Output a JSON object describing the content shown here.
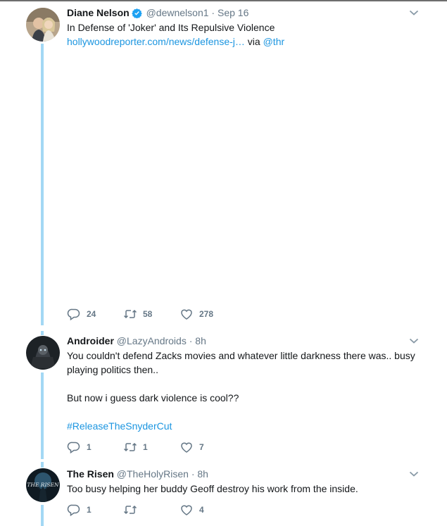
{
  "tweets": [
    {
      "name": "Diane Nelson",
      "verified": true,
      "handle": "@dewnelson1",
      "dot": "·",
      "time": "Sep 16",
      "text_line1": "In Defense of 'Joker' and Its Repulsive Violence",
      "link": "hollywoodreporter.com/news/defense-j…",
      "via": "via",
      "mention": "@thr",
      "replies": "24",
      "retweets": "58",
      "likes": "278"
    },
    {
      "name": "Androider",
      "handle": "@LazyAndroids",
      "dot": "·",
      "time": "8h",
      "text_line1": "You couldn't defend Zacks movies and whatever little darkness there was.. busy",
      "text_line2": "playing politics then..",
      "text_line3": "But now i guess dark violence is cool??",
      "hashtag": "#ReleaseTheSnyderCut",
      "replies": "1",
      "retweets": "1",
      "likes": "7"
    },
    {
      "name": "The Risen",
      "handle": "@TheHolyRisen",
      "dot": "·",
      "time": "8h",
      "avatar_text": "THE RISEN",
      "text_line1": "Too busy helping her buddy Geoff destroy his work from the inside.",
      "replies": "1",
      "retweets": "",
      "likes": "4"
    }
  ],
  "colors": {
    "link": "#1b95e0",
    "thread_line": "#a3d8f4",
    "muted": "#657786",
    "verified": "#1da1f2"
  },
  "icons": [
    "chevron-down-icon",
    "verified-badge-icon",
    "reply-icon",
    "retweet-icon",
    "like-icon"
  ]
}
